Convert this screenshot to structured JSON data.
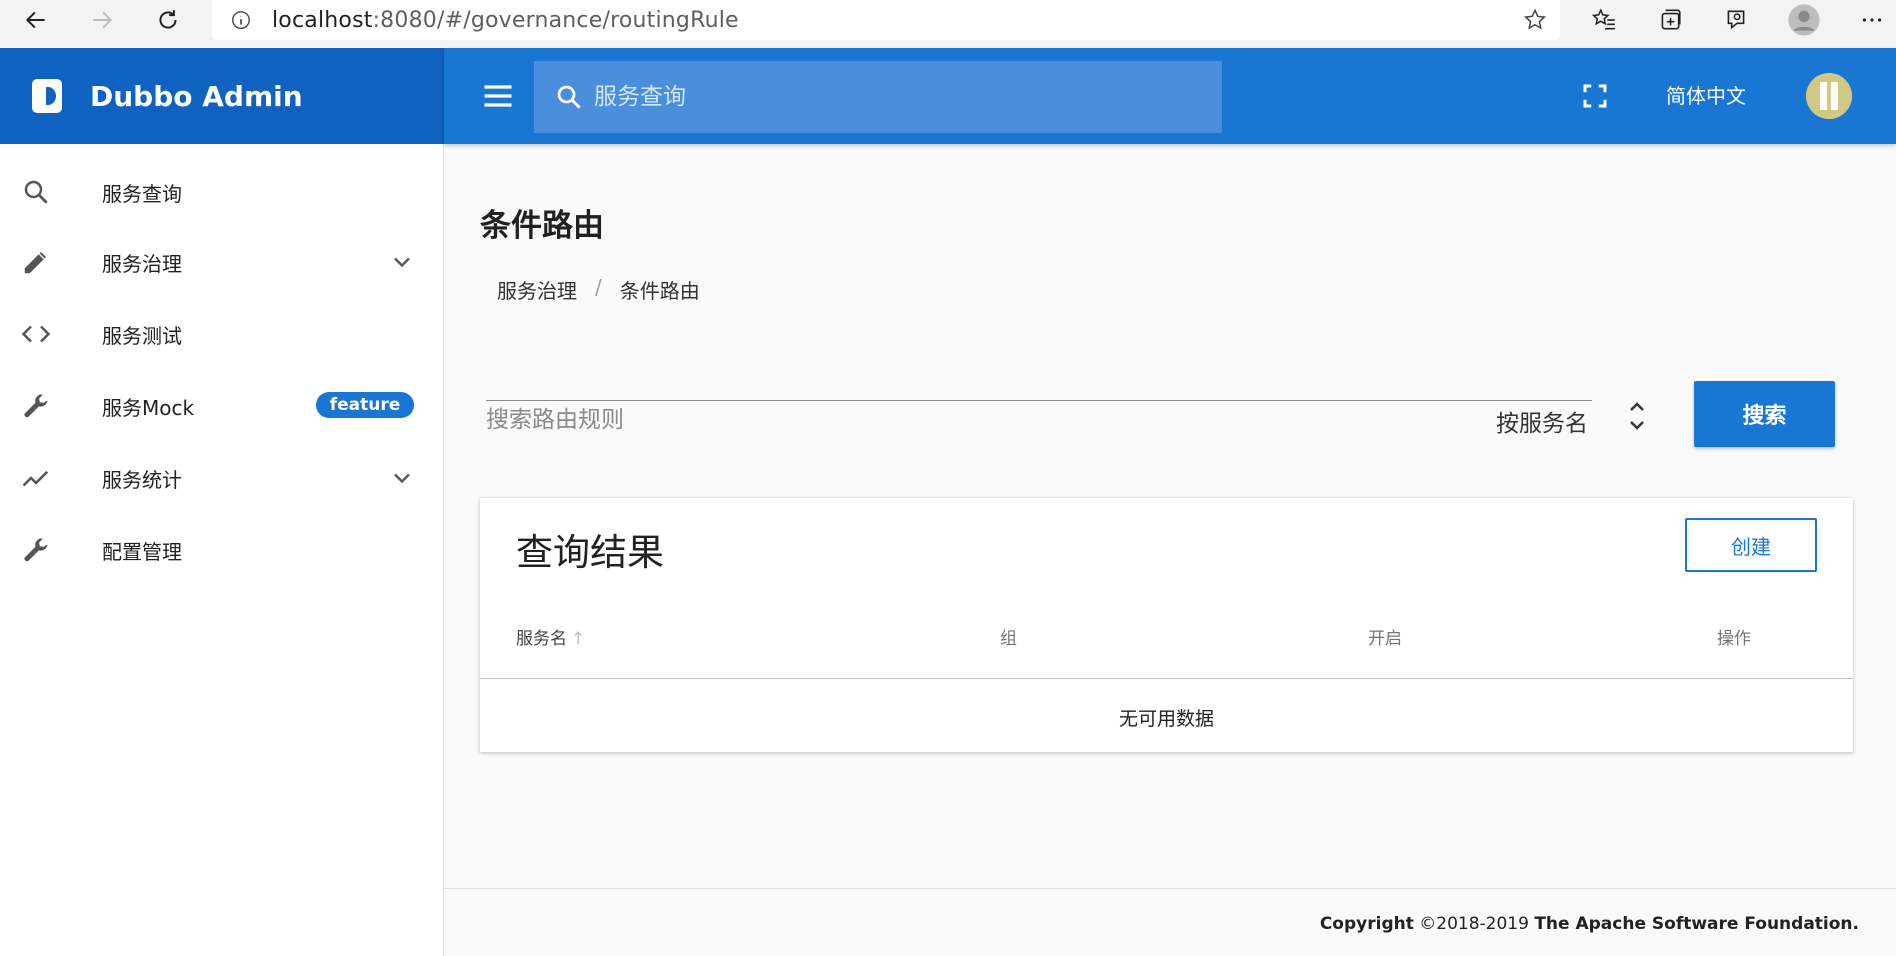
{
  "browser": {
    "url_host": "localhost",
    "url_rest": ":8080/#/governance/routingRule"
  },
  "app": {
    "brand": "Dubbo Admin",
    "search_placeholder": "服务查询",
    "language": "简体中文",
    "accent_color": "#1976d2"
  },
  "sidebar": {
    "items": [
      {
        "label": "服务查询",
        "icon": "search-icon"
      },
      {
        "label": "服务治理",
        "icon": "pencil-icon",
        "expandable": true
      },
      {
        "label": "服务测试",
        "icon": "code-icon"
      },
      {
        "label": "服务Mock",
        "icon": "wrench-icon",
        "badge": "feature"
      },
      {
        "label": "服务统计",
        "icon": "trending-icon",
        "expandable": true
      },
      {
        "label": "配置管理",
        "icon": "wrench-icon"
      }
    ]
  },
  "page": {
    "title": "条件路由",
    "breadcrumb": [
      "服务治理",
      "条件路由"
    ]
  },
  "filter": {
    "placeholder": "搜索路由规则",
    "select_value": "按服务名",
    "search_label": "搜索"
  },
  "results": {
    "title": "查询结果",
    "create_label": "创建",
    "columns": [
      "服务名",
      "组",
      "开启",
      "操作"
    ],
    "empty_text": "无可用数据"
  },
  "footer": {
    "prefix": "Copyright",
    "years": "©2018-2019",
    "org": "The Apache Software Foundation."
  }
}
